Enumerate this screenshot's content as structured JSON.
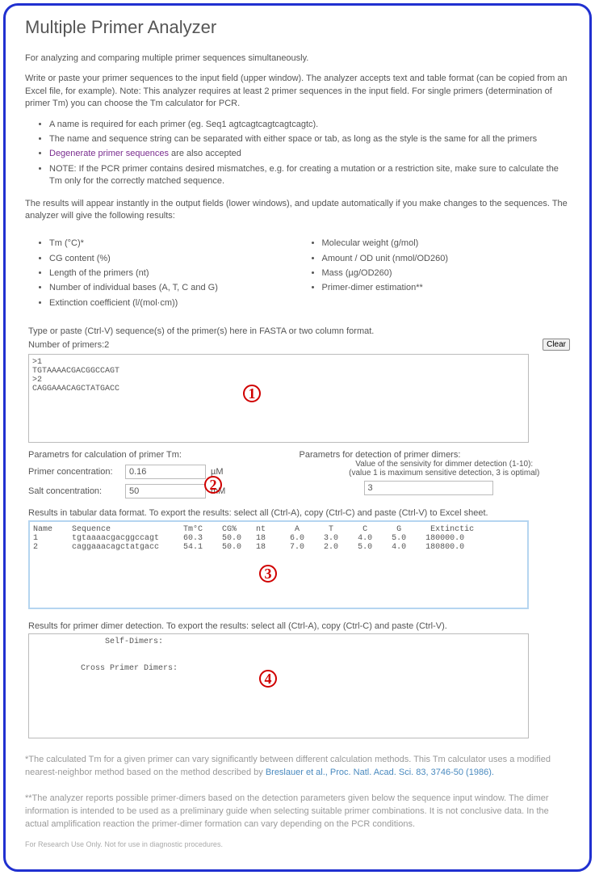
{
  "title": "Multiple Primer Analyzer",
  "intro": "For analyzing and comparing multiple primer sequences simultaneously.",
  "desc": "Write or paste your primer sequences to the input field (upper window). The analyzer accepts text and table format (can be copied from an Excel file, for example). Note: This analyzer requires at least 2 primer sequences in the input field. For single primers (determination of primer Tm) you can choose the Tm calculator for PCR.",
  "notes": {
    "n1": "A name is required for each primer (eg. Seq1 agtcagtcagtcagtcagtc).",
    "n2": "The name and sequence string can be separated with either space or tab, as long as the style is the same for all the primers",
    "n3a": "Degenerate primer sequences",
    "n3b": " are also accepted",
    "n4": "NOTE: If the PCR primer contains desired mismatches, e.g. for creating a mutation or a restriction site, make sure to calculate the Tm only for the correctly matched sequence."
  },
  "results_intro": "The results will appear instantly in the output fields (lower windows), and update automatically if you make changes to the sequences. The analyzer will give the following results:",
  "outputs_left": {
    "o1": "Tm (°C)*",
    "o2": "CG content (%)",
    "o3": "Length of the primers (nt)",
    "o4": "Number of individual bases (A, T, C and G)",
    "o5": "Extinction coefficient (l/(mol·cm))"
  },
  "outputs_right": {
    "o1": "Molecular weight (g/mol)",
    "o2": "Amount / OD unit (nmol/OD260)",
    "o3": "Mass (µg/OD260)",
    "o4": "Primer-dimer estimation**"
  },
  "input_hint": "Type or paste (Ctrl-V) sequence(s) of the primer(s) here in FASTA or two column format.",
  "num_primers_label": "Number of primers: ",
  "num_primers": "2",
  "clear_label": "Clear",
  "input_text": ">1\nTGTAAAACGACGGCCAGT\n>2\nCAGGAAACAGCTATGACC",
  "params_tm_header": "Parametrs for calculation of primer Tm:",
  "primer_conc_label": "Primer concentration:",
  "primer_conc": "0.16",
  "primer_conc_unit": "µM",
  "salt_conc_label": "Salt concentration:",
  "salt_conc": "50",
  "salt_conc_unit": "mM",
  "params_dimer_header": "Parametrs for detection of primer dimers:",
  "sens_label": "Value of the sensivity for dimmer detection (1-10):",
  "sens_note": "(value 1 is maximum sensitive detection, 3 is optimal)",
  "sens_value": "3",
  "results_hint": "Results in tabular data format. To export the results: select all (Ctrl-A), copy (Ctrl-C) and paste (Ctrl-V) to Excel sheet.",
  "results_text": "Name    Sequence               Tm°C    CG%    nt      A      T      C      G      Extinctic\n1       tgtaaaacgacggccagt     60.3    50.0   18     6.0    3.0    4.0    5.0    180000.0\n2       caggaaacagctatgacc     54.1    50.0   18     7.0    2.0    5.0    4.0    180800.0\n",
  "dimers_hint": "Results for primer dimer detection. To export the results: select all (Ctrl-A), copy (Ctrl-C) and paste (Ctrl-V).",
  "dimers_text": "               Self-Dimers:\n\n\n          Cross Primer Dimers:",
  "foot1a": "*The calculated Tm for a given primer can vary significantly between different calculation methods. This Tm calculator uses a modified nearest-neighbor method based on the method described by ",
  "foot1b": "Breslauer et al., Proc. Natl. Acad. Sci. 83, 3746-50 (1986).",
  "foot2": "**The analyzer reports possible primer-dimers based on the detection parameters given below the sequence input window. The dimer information is intended to be used as a preliminary guide when selecting suitable primer combinations. It is not conclusive data. In the actual amplification reaction the primer-dimer formation can vary depending on the PCR conditions.",
  "foot3": "For Research Use Only. Not for use in diagnostic procedures.",
  "ann": {
    "a1": "1",
    "a2": "2",
    "a3": "3",
    "a4": "4"
  }
}
